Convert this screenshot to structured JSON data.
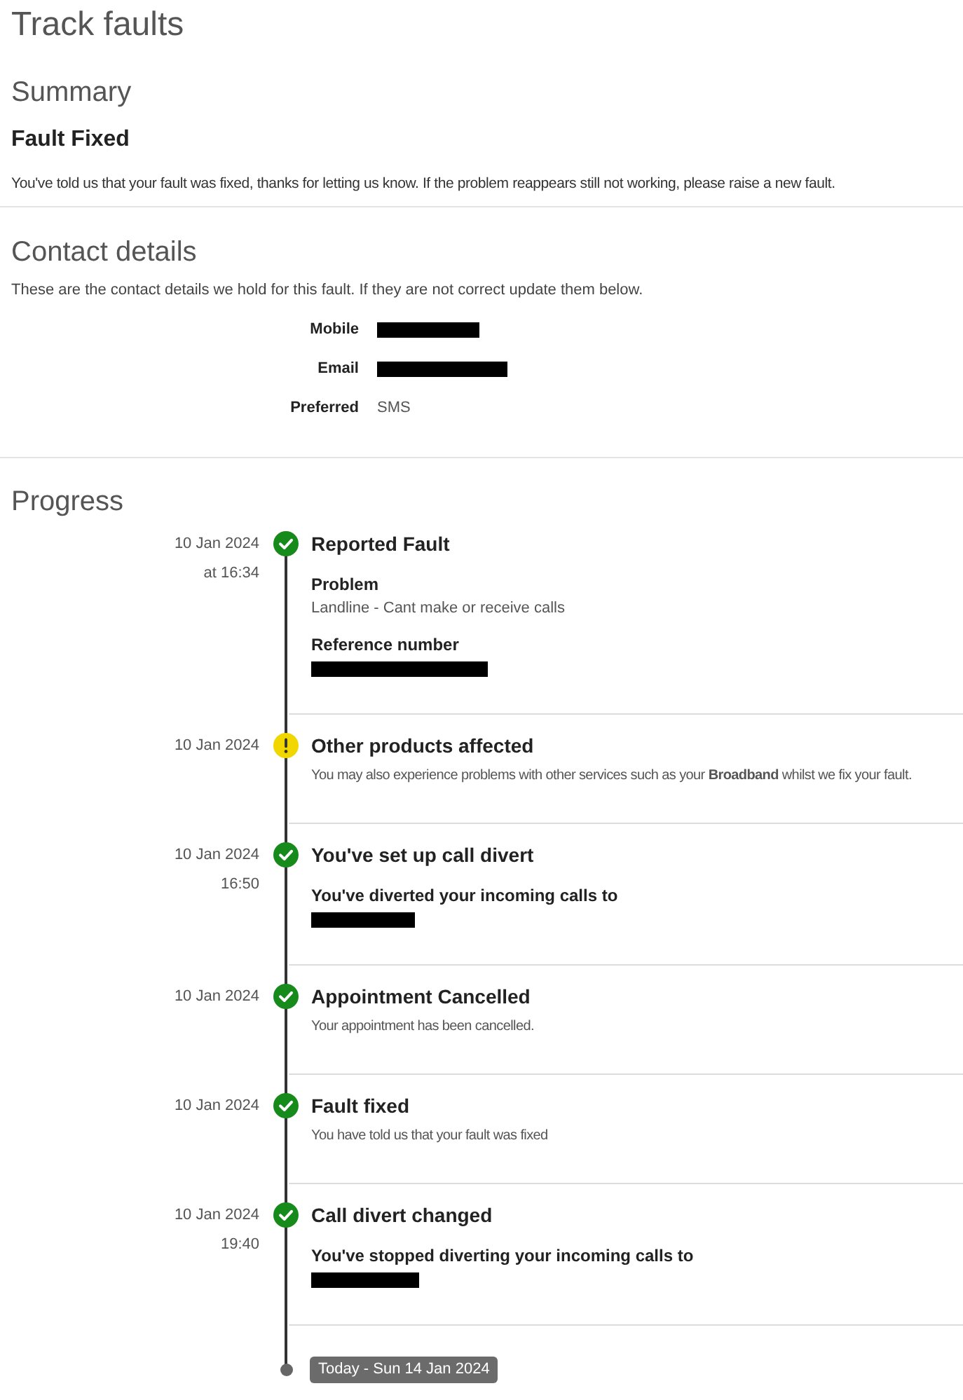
{
  "page": {
    "title": "Track faults"
  },
  "summary": {
    "heading": "Summary",
    "status": "Fault Fixed",
    "message": "You've told us that your fault was fixed, thanks for letting us know. If the problem reappears still not working, please raise a new fault."
  },
  "contact": {
    "heading": "Contact details",
    "intro": "These are the contact details we hold for this fault. If they are not correct update them below.",
    "rows": [
      {
        "label": "Mobile",
        "kind": "redacted"
      },
      {
        "label": "Email",
        "kind": "redacted"
      },
      {
        "label": "Preferred",
        "kind": "text",
        "value": "SMS"
      }
    ]
  },
  "progress": {
    "heading": "Progress",
    "events": [
      {
        "date": "10 Jan 2024",
        "time": "at 16:34",
        "kind": "done",
        "title": "Reported Fault",
        "details": [
          {
            "kind": "field",
            "label": "Problem",
            "value": "Landline - Cant make or receive calls"
          },
          {
            "kind": "redacted_field",
            "label": "Reference number"
          }
        ]
      },
      {
        "date": "10 Jan 2024",
        "kind": "warning",
        "title": "Other products affected",
        "details": [
          {
            "kind": "text",
            "text": "You may also experience problems with other services such as your **Broadband** whilst we fix your fault."
          }
        ]
      },
      {
        "date": "10 Jan 2024",
        "time": "16:50",
        "kind": "done",
        "title": "You've set up call divert",
        "details": [
          {
            "kind": "redacted_field",
            "label": "You've diverted your incoming calls to"
          }
        ]
      },
      {
        "date": "10 Jan 2024",
        "kind": "done",
        "title": "Appointment Cancelled",
        "details": [
          {
            "kind": "text",
            "text": "Your appointment has been cancelled."
          }
        ]
      },
      {
        "date": "10 Jan 2024",
        "kind": "done",
        "title": "Fault fixed",
        "details": [
          {
            "kind": "text",
            "text": "You have told us that your fault was fixed"
          }
        ]
      },
      {
        "date": "10 Jan 2024",
        "time": "19:40",
        "kind": "done",
        "title": "Call divert changed",
        "details": [
          {
            "kind": "redacted_field",
            "label": "You've stopped diverting your incoming calls to"
          }
        ]
      }
    ],
    "today": "Today - Sun 14 Jan 2024"
  }
}
